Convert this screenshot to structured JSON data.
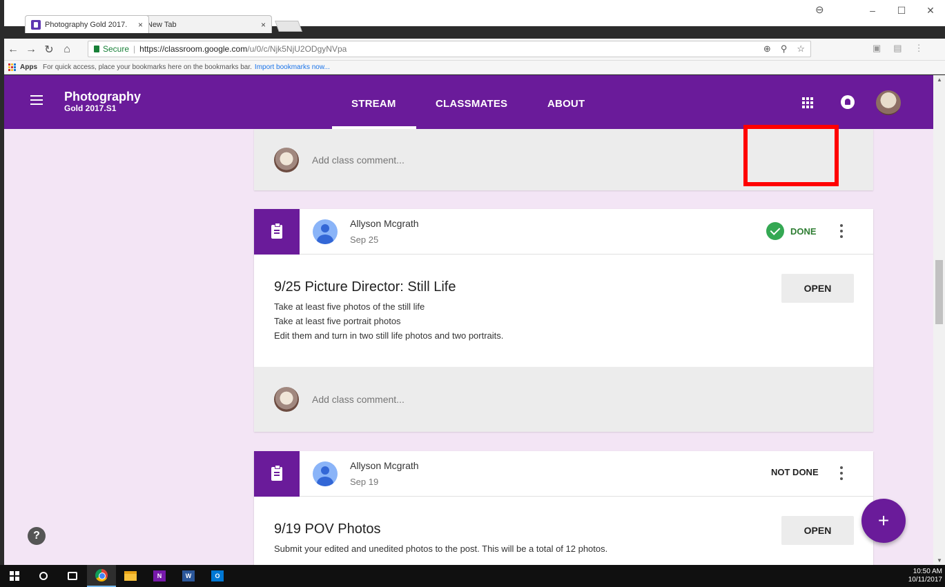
{
  "browser": {
    "tabs": [
      {
        "title": "Photography Gold 2017.",
        "close": "×"
      },
      {
        "title": "New Tab",
        "close": "×"
      }
    ],
    "window_controls": {
      "minimize": "–",
      "maximize": "☐",
      "close": "✕"
    },
    "address": {
      "secure_label": "Secure",
      "url_host": "https://classroom.google.com",
      "url_path": "/u/0/c/Njk5NjU2ODgyNVpa"
    },
    "bookmarks": {
      "apps_label": "Apps",
      "hint": "For quick access, place your bookmarks here on the bookmarks bar.",
      "import_link": "Import bookmarks now..."
    }
  },
  "appbar": {
    "class_name": "Photography",
    "section": "Gold 2017.S1",
    "tabs": [
      "STREAM",
      "CLASSMATES",
      "ABOUT"
    ],
    "active_tab": "STREAM"
  },
  "stream": {
    "comment_placeholder": "Add class comment...",
    "posts": [
      {
        "author": "Allyson Mcgrath",
        "date": "Sep 25",
        "status": "DONE",
        "title": "9/25 Picture Director: Still Life",
        "lines": [
          "Take at least five photos of the still life",
          "Take at least five portrait photos",
          "Edit them and turn in two still life photos and two portraits."
        ],
        "open_label": "OPEN"
      },
      {
        "author": "Allyson Mcgrath",
        "date": "Sep 19",
        "status": "NOT DONE",
        "title": "9/19 POV Photos",
        "lines": [
          "Submit your edited and unedited photos to the post. This will be a total of 12 photos."
        ],
        "open_label": "OPEN"
      }
    ]
  },
  "help_label": "?",
  "fab_label": "+",
  "taskbar": {
    "onenote_label": "N",
    "word_label": "W",
    "outlook_label": "O",
    "time": "10:50 AM",
    "date": "10/11/2017"
  },
  "colors": {
    "brand_purple": "#6a1b9a",
    "page_bg": "#f3e5f5",
    "done_green": "#34a853",
    "highlight_red": "#ff0000"
  }
}
